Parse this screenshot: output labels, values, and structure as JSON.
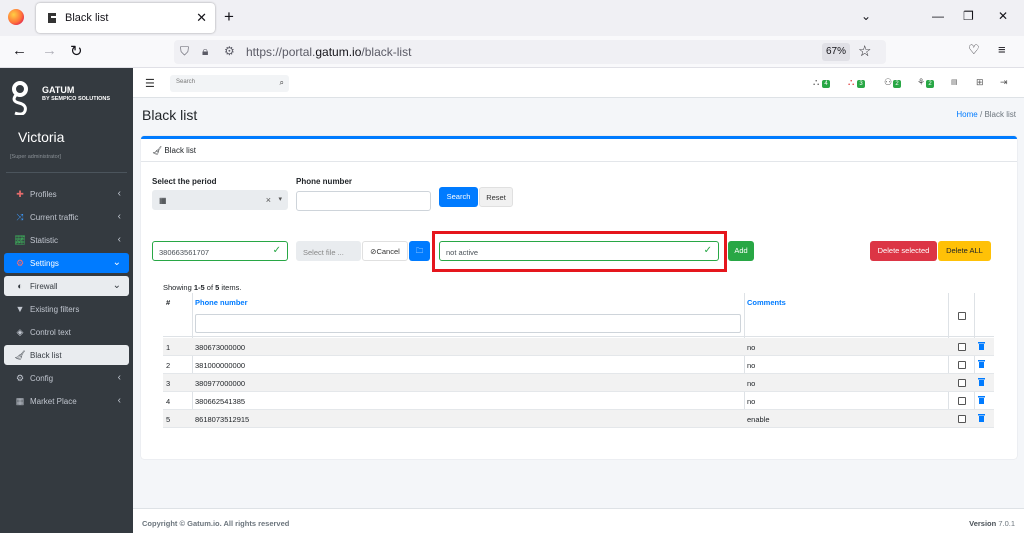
{
  "browser": {
    "tab_title": "Black list",
    "url_prefix": "https://portal.",
    "url_domain": "gatum.io",
    "url_path": "/black-list",
    "zoom": "67%"
  },
  "sidebar": {
    "brand_name": "GATUM",
    "brand_sub": "BY SEMPICO SOLUTIONS",
    "user_name": "Victoria",
    "user_role": "[Super administrator]",
    "items": [
      {
        "label": "Profiles",
        "icon": "puzzle-icon"
      },
      {
        "label": "Current traffic",
        "icon": "shuffle-icon"
      },
      {
        "label": "Statistic",
        "icon": "chart-icon"
      },
      {
        "label": "Settings",
        "icon": "cogs-icon"
      },
      {
        "label": "Firewall",
        "icon": "shield-icon"
      },
      {
        "label": "Existing filters",
        "icon": "filter-icon"
      },
      {
        "label": "Control text",
        "icon": "eraser-icon"
      },
      {
        "label": "Black list",
        "icon": "broom-icon"
      },
      {
        "label": "Config",
        "icon": "gear-icon"
      },
      {
        "label": "Market Place",
        "icon": "grid-icon"
      }
    ]
  },
  "header": {
    "search_placeholder": "Search",
    "badges": [
      "4",
      "3",
      "2",
      "2"
    ]
  },
  "page": {
    "title": "Black list",
    "breadcrumb_home": "Home",
    "breadcrumb_sep": "/",
    "breadcrumb_current": "Black list",
    "card_title": "Black list"
  },
  "filters": {
    "period_label": "Select the period",
    "period_clear": "×",
    "phone_label": "Phone number",
    "search_button": "Search",
    "reset_button": "Reset"
  },
  "add_form": {
    "phone_value": "380663561707",
    "file_placeholder": "Select file ...",
    "cancel_label": "Cancel",
    "comment_value": "not active",
    "add_button": "Add",
    "delete_selected": "Delete selected",
    "delete_all": "Delete ALL"
  },
  "summary": {
    "prefix": "Showing ",
    "range": "1-5",
    "mid": " of ",
    "total": "5",
    "suffix": " items."
  },
  "table": {
    "headers": {
      "num": "#",
      "phone": "Phone number",
      "comments": "Comments"
    },
    "rows": [
      {
        "num": "1",
        "phone": "380673000000",
        "comment": "no"
      },
      {
        "num": "2",
        "phone": "381000000000",
        "comment": "no"
      },
      {
        "num": "3",
        "phone": "380977000000",
        "comment": "no"
      },
      {
        "num": "4",
        "phone": "380662541385",
        "comment": "no"
      },
      {
        "num": "5",
        "phone": "8618073512915",
        "comment": "enable"
      }
    ]
  },
  "footer": {
    "copyright": "Copyright © Gatum.io. All rights reserved",
    "version_label": "Version",
    "version": "7.0.1"
  },
  "colors": {
    "primary": "#007bff",
    "success": "#28a745",
    "danger": "#dc3545",
    "warning": "#ffc107",
    "sidebar": "#343a40",
    "highlight": "#e5161d"
  }
}
